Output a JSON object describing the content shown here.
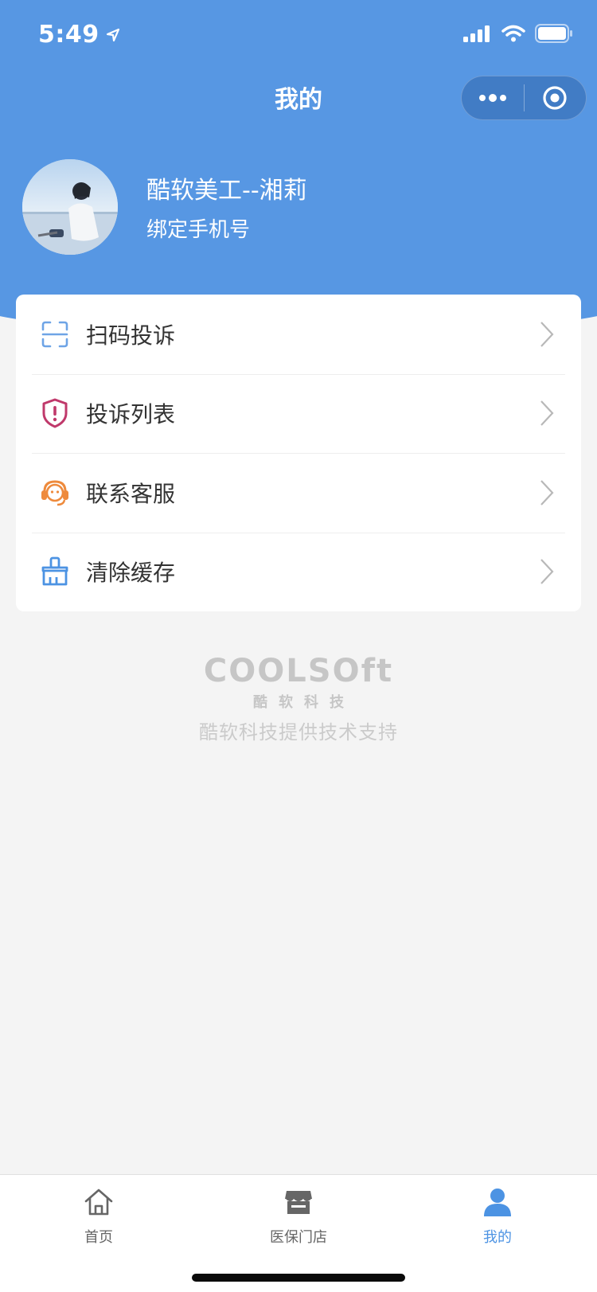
{
  "status_bar": {
    "time": "5:49"
  },
  "nav": {
    "title": "我的"
  },
  "profile": {
    "name": "酷软美工--湘莉",
    "subtitle": "绑定手机号"
  },
  "menu": [
    {
      "label": "扫码投诉",
      "icon": "scan-icon"
    },
    {
      "label": "投诉列表",
      "icon": "shield-alert-icon"
    },
    {
      "label": "联系客服",
      "icon": "headset-icon"
    },
    {
      "label": "清除缓存",
      "icon": "broom-icon"
    }
  ],
  "brand": {
    "logo": "COOLSOft",
    "cn_name": "酷软科技",
    "support": "酷软科技提供技术支持"
  },
  "tabbar": {
    "tabs": [
      {
        "label": "首页",
        "icon": "home-icon",
        "active": false
      },
      {
        "label": "医保门店",
        "icon": "store-icon",
        "active": false
      },
      {
        "label": "我的",
        "icon": "user-icon",
        "active": true
      }
    ]
  },
  "colors": {
    "header_blue": "#5797e3",
    "active_tab": "#4c93e3",
    "scan_icon": "#6ea4e6",
    "shield_icon": "#c0396b",
    "headset_icon": "#ee8a3c",
    "broom_icon": "#4c93e3"
  }
}
